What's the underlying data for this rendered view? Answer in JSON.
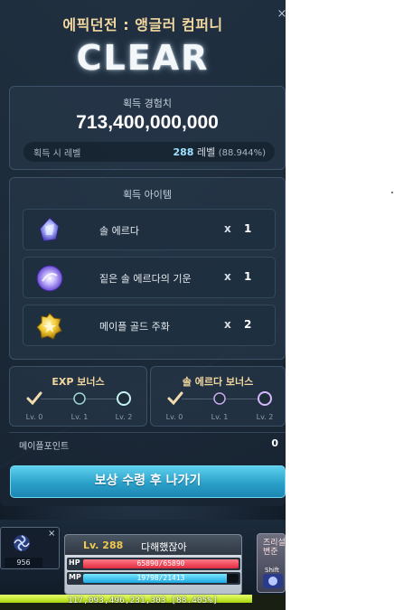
{
  "dialog": {
    "title": "에픽던전 : 앵글러 컴퍼니",
    "clear": "CLEAR",
    "close": "×",
    "exp": {
      "label": "획득 경험치",
      "value": "713,400,000,000",
      "level_label": "획득 시 레벨",
      "level_num": "288",
      "level_unit": "레벨",
      "level_pct": "(88.944%)"
    },
    "items": {
      "label": "획득 아이템",
      "list": [
        {
          "name": "솔 에르다",
          "x": "x",
          "qty": "1",
          "icon": "sol-erda-icon"
        },
        {
          "name": "짙은 솔 에르다의 기운",
          "x": "x",
          "qty": "1",
          "icon": "sol-erda-energy-icon"
        },
        {
          "name": "메이플 골드 주화",
          "x": "x",
          "qty": "2",
          "icon": "maple-gold-coin-icon"
        }
      ]
    },
    "exp_bonus": {
      "title": "EXP 보너스",
      "levels": [
        "Lv. 0",
        "Lv. 1",
        "Lv. 2"
      ]
    },
    "erda_bonus": {
      "title": "솔 에르다 보너스",
      "levels": [
        "Lv. 0",
        "Lv. 1",
        "Lv. 2"
      ]
    },
    "maple_points": {
      "label": "메이플포인트",
      "value": "0"
    },
    "reward_button": "보상 수령 후 나가기"
  },
  "hud": {
    "buff": {
      "count": "956",
      "close": "×"
    },
    "level": "Lv. 288",
    "name": "다해했잖아",
    "hp": {
      "tag": "HP",
      "text": "65890/65890",
      "fraction": 1.0
    },
    "mp": {
      "tag": "MP",
      "text": "19798/21413",
      "fraction": 0.9246
    },
    "skill": {
      "text": "즈리설 변준",
      "shift": "Shift"
    },
    "exp": {
      "text": "117,093,496,231,303 [88.405%]",
      "fraction": 0.884
    }
  },
  "colors": {
    "accent_gold": "#f2d7a0",
    "button_blue": "#2aa0c9",
    "level_cyan": "#9fe2ff",
    "exp_green": "#a8d60f"
  }
}
